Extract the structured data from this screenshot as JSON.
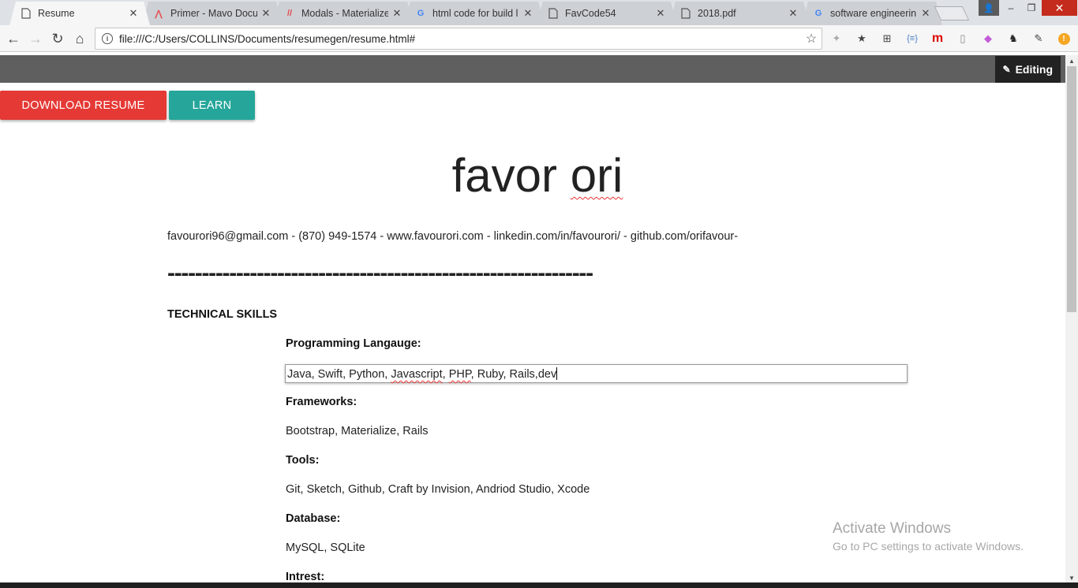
{
  "browser": {
    "tabs": [
      {
        "title": "Resume",
        "icon": "page-icon",
        "active": true
      },
      {
        "title": "Primer - Mavo Docu",
        "icon": "mavo-icon",
        "active": false
      },
      {
        "title": "Modals - Materialize",
        "icon": "materialize-icon",
        "active": false
      },
      {
        "title": "html code for build l",
        "icon": "google-icon",
        "active": false
      },
      {
        "title": "FavCode54",
        "icon": "page-icon",
        "active": false
      },
      {
        "title": "2018.pdf",
        "icon": "page-icon",
        "active": false
      },
      {
        "title": "software engineerin",
        "icon": "google-icon",
        "active": false
      }
    ],
    "url": "file:///C:/Users/COLLINS/Documents/resumegen/resume.html#",
    "accent": "#e53935"
  },
  "mavo": {
    "editing_label": "Editing"
  },
  "actions": {
    "download_label": "DOWNLOAD RESUME",
    "learn_label": "LEARN",
    "download_color": "#e53935",
    "learn_color": "#26a69a"
  },
  "resume": {
    "name_first": "favor",
    "name_last": "ori",
    "contact": "favourori96@gmail.com - (870) 949-1574 - www.favourori.com - linkedin.com/in/favourori/ - github.com/orifavour-",
    "divider": "--------------------------------------------------------------",
    "section_title": "TECHNICAL SKILLS",
    "skills": {
      "programming_label": "Programming Langauge:",
      "programming_value_1": "Java, Swift, Python, ",
      "programming_value_2": "Javascript",
      "programming_value_3": ", ",
      "programming_value_4": "PHP",
      "programming_value_5": ", Ruby, Rails,dev",
      "frameworks_label": "Frameworks:",
      "frameworks_value": "Bootstrap, Materialize, Rails",
      "tools_label": "Tools:",
      "tools_value": "Git, Sketch, Github, Craft by Invision, Andriod Studio, Xcode",
      "database_label": "Database:",
      "database_value": "MySQL, SQLite",
      "interest_label": "Intrest:"
    }
  },
  "watermark": {
    "line1": "Activate Windows",
    "line2": "Go to PC settings to activate Windows."
  }
}
